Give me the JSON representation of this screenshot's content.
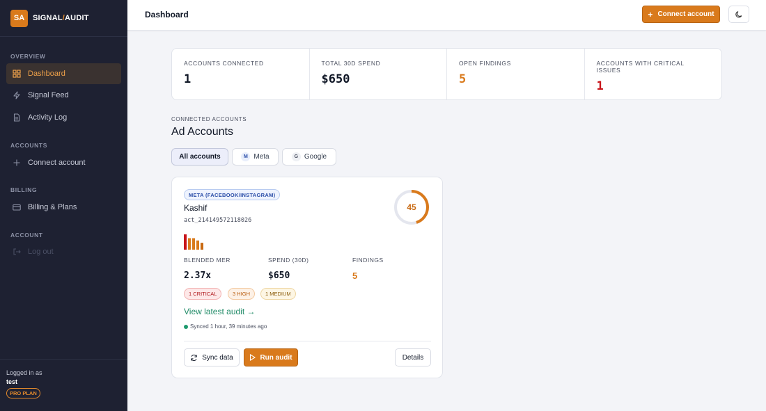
{
  "brand": {
    "logo": "SA",
    "name_a": "SIGNAL",
    "name_sep": "/",
    "name_b": "AUDIT"
  },
  "sidebar": {
    "sections": [
      {
        "label": "OVERVIEW"
      },
      {
        "label": "ACCOUNTS"
      },
      {
        "label": "BILLING"
      },
      {
        "label": "ACCOUNT"
      }
    ],
    "items": [
      {
        "label": "Dashboard",
        "icon": "grid-icon",
        "active": true
      },
      {
        "label": "Signal Feed",
        "icon": "bolt-icon"
      },
      {
        "label": "Activity Log",
        "icon": "document-icon"
      },
      {
        "label": "Connect account",
        "icon": "plus-icon"
      },
      {
        "label": "Billing & Plans",
        "icon": "card-icon"
      },
      {
        "label": "Log out",
        "icon": "logout-icon"
      }
    ],
    "footer": {
      "logged_in_label": "Logged in as",
      "user": "test",
      "plan": "PRO PLAN"
    }
  },
  "topbar": {
    "title": "Dashboard",
    "connect_label": "Connect account",
    "theme_icon": "moon-icon"
  },
  "stats": [
    {
      "label": "ACCOUNTS CONNECTED",
      "value": "1"
    },
    {
      "label": "TOTAL 30D SPEND",
      "value": "$650"
    },
    {
      "label": "OPEN FINDINGS",
      "value": "5"
    },
    {
      "label": "ACCOUNTS WITH CRITICAL ISSUES",
      "value": "1"
    }
  ],
  "accounts": {
    "eyebrow": "CONNECTED ACCOUNTS",
    "title": "Ad Accounts",
    "filters": [
      {
        "label": "All accounts",
        "active": true
      },
      {
        "label": "Meta",
        "badge": "M"
      },
      {
        "label": "Google",
        "badge": "G"
      }
    ]
  },
  "card": {
    "platform": "META (FACEBOOK/INSTAGRAM)",
    "name": "Kashif",
    "account_id": "act_214149572118026",
    "score": 45,
    "severity_bars": [
      1.0,
      0.75,
      0.75,
      0.6,
      0.45
    ],
    "metrics": [
      {
        "label": "BLENDED MER",
        "value": "2.37x"
      },
      {
        "label": "SPEND (30D)",
        "value": "$650"
      },
      {
        "label": "FINDINGS",
        "value": "5"
      }
    ],
    "severities": [
      {
        "label": "1 CRITICAL"
      },
      {
        "label": "3 HIGH"
      },
      {
        "label": "1 MEDIUM"
      }
    ],
    "audit_link": "View latest audit →",
    "synced": "Synced 1 hour, 39 minutes ago",
    "sync_label": "Sync data",
    "run_label": "Run audit",
    "details_label": "Details"
  },
  "colors": {
    "accent": "#d97a1c",
    "sidebar_bg": "#1e2132",
    "critical": "#c8141a",
    "success": "#1e8a66"
  }
}
